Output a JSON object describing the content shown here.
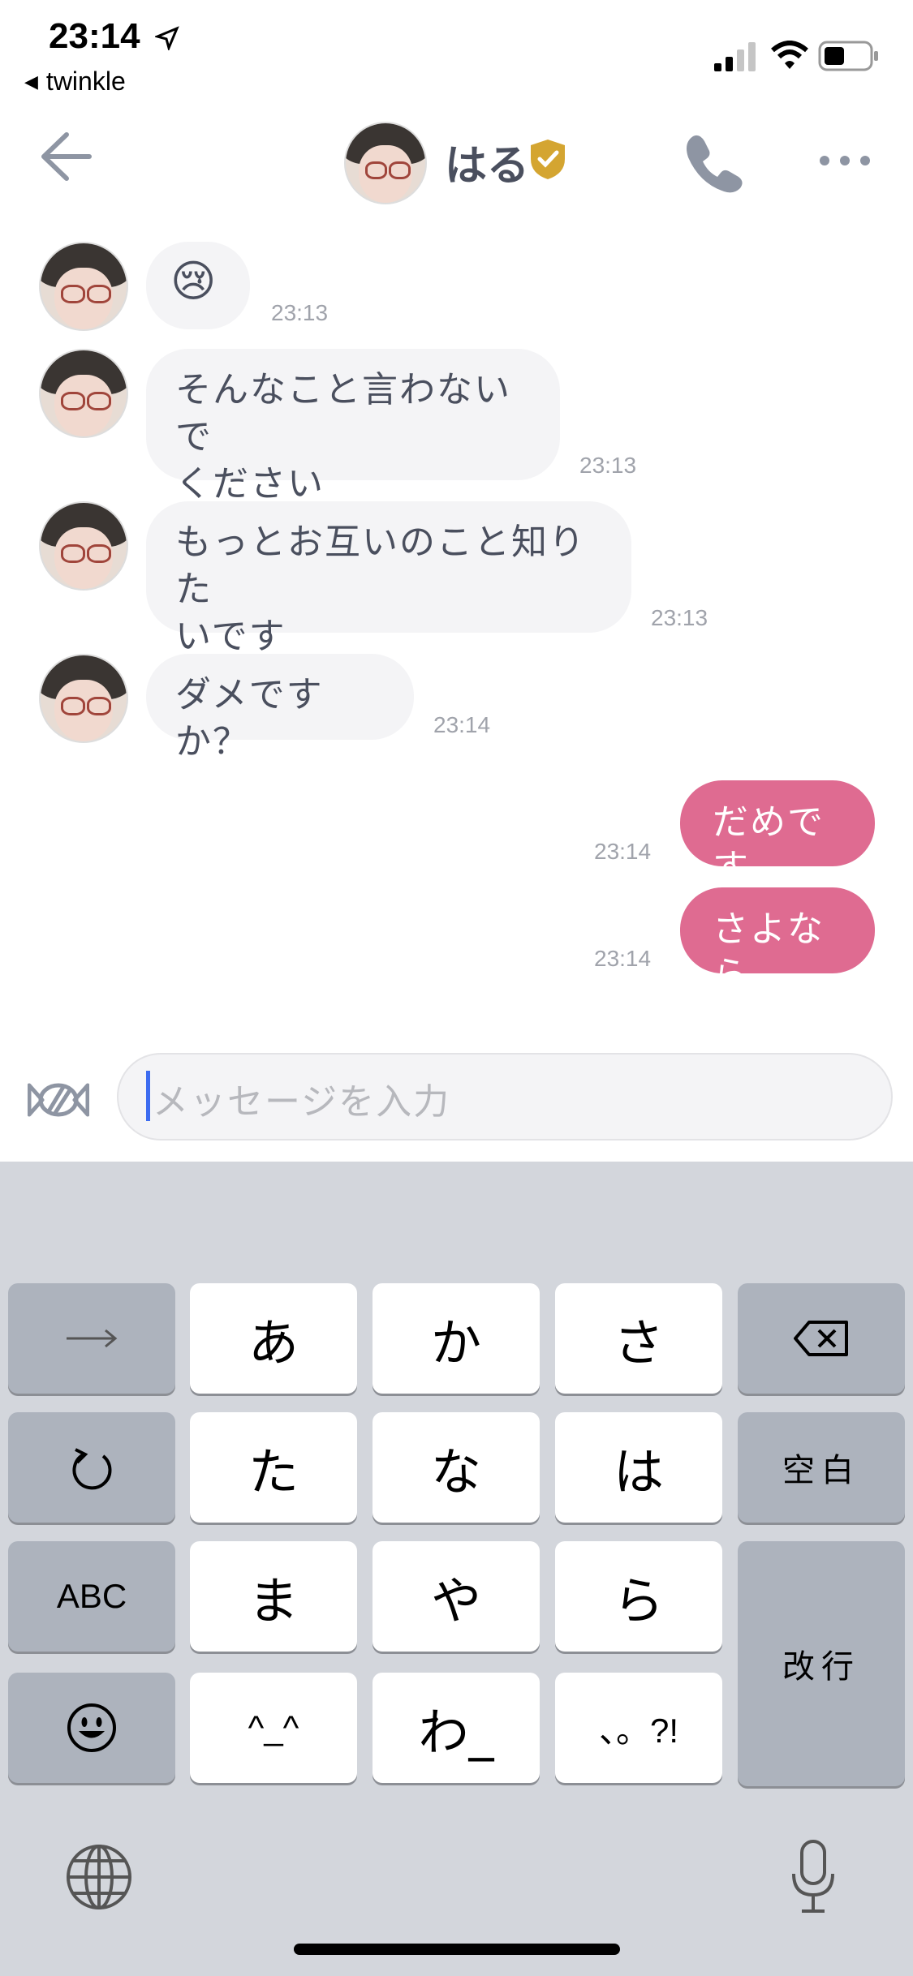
{
  "status_bar": {
    "time": "23:14",
    "back_app": "twinkle"
  },
  "header": {
    "name": "はる"
  },
  "messages_in": [
    {
      "text": "😢",
      "time": "23:13"
    },
    {
      "text": "そんなこと言わないでください",
      "line1": "そんなこと言わないで",
      "line2": "ください",
      "time": "23:13"
    },
    {
      "text": "もっとお互いのこと知りたいです",
      "line1": "もっとお互いのこと知りた",
      "line2": "いです",
      "time": "23:13"
    },
    {
      "text": "ダメですか？",
      "time": "23:14"
    }
  ],
  "messages_out": [
    {
      "text": "だめです",
      "time": "23:14"
    },
    {
      "text": "さよなら",
      "time": "23:14"
    }
  ],
  "input": {
    "placeholder": "メッセージを入力"
  },
  "keyboard": {
    "rows": [
      [
        "→",
        "あ",
        "か",
        "さ",
        "⌫"
      ],
      [
        "↺",
        "た",
        "な",
        "は",
        "空白"
      ],
      [
        "ABC",
        "ま",
        "や",
        "ら",
        "改行"
      ],
      [
        "☺",
        "^^",
        "わ",
        "、。?!"
      ]
    ],
    "labels": {
      "next": "→",
      "a": "あ",
      "ka": "か",
      "sa": "さ",
      "undo": "↺",
      "ta": "た",
      "na": "な",
      "ha": "は",
      "space": "空白",
      "abc": "ABC",
      "ma": "ま",
      "ya": "や",
      "ra": "ら",
      "return": "改行",
      "emoji": "☺",
      "kao": "^_^",
      "wa": "わ_",
      "punct": "、。?!"
    }
  },
  "colors": {
    "accent": "#df6b91",
    "badge": "#d4a531",
    "caret": "#3d6cf0"
  },
  "icons": [
    "location-arrow-icon",
    "signal-icon",
    "wifi-icon",
    "battery-icon",
    "back-arrow-icon",
    "verified-badge-icon",
    "phone-icon",
    "more-icon",
    "candy-icon",
    "delete-icon",
    "undo-icon",
    "emoji-icon",
    "globe-icon",
    "microphone-icon"
  ]
}
